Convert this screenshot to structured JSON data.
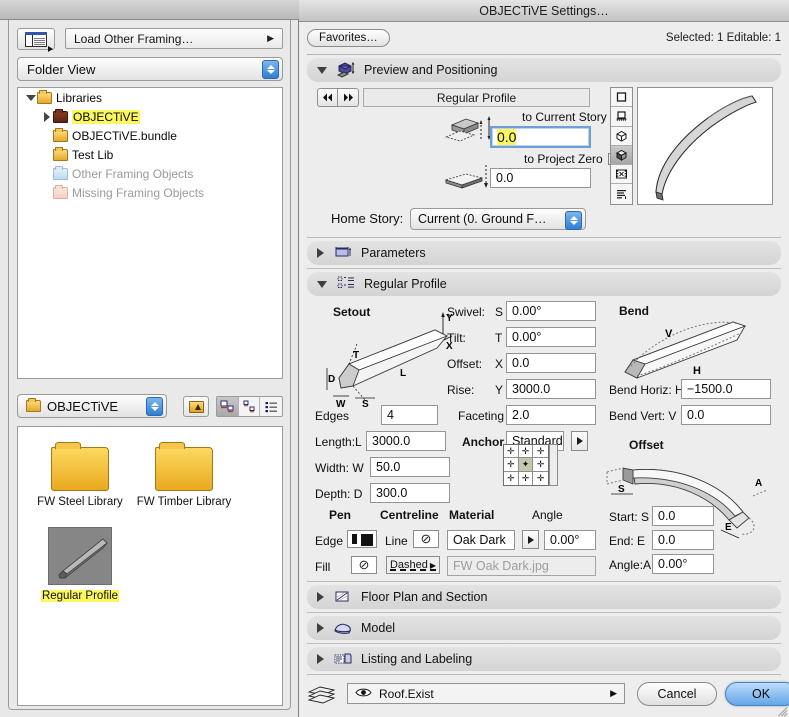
{
  "window": {
    "title": "OBJECTiVE Settings…"
  },
  "browser": {
    "listview_icon": "list-view-icon",
    "load_popup": "Load Other Framing…",
    "view_mode": "Folder View",
    "tree": [
      {
        "label": "Libraries",
        "indent": 0,
        "twisty": "down",
        "folder": "yellow",
        "dim": false,
        "highlight": false
      },
      {
        "label": "OBJECTiVE",
        "indent": 1,
        "twisty": "right",
        "folder": "dark",
        "dim": false,
        "highlight": true
      },
      {
        "label": "OBJECTiVE.bundle",
        "indent": 1,
        "twisty": "none",
        "folder": "yellow",
        "dim": false,
        "highlight": false
      },
      {
        "label": "Test Lib",
        "indent": 1,
        "twisty": "none",
        "folder": "yellow",
        "dim": false,
        "highlight": false
      },
      {
        "label": "Other Framing Objects",
        "indent": 1,
        "twisty": "none",
        "folder": "blue",
        "dim": true,
        "highlight": false
      },
      {
        "label": "Missing Framing Objects",
        "indent": 1,
        "twisty": "none",
        "folder": "pink",
        "dim": true,
        "highlight": false
      }
    ],
    "folder_popup": "OBJECTiVE",
    "up_button": "enclosing-folder-icon",
    "view_modes": [
      "large-icon-view",
      "small-icon-view",
      "list-detail-view"
    ],
    "items": [
      {
        "label": "FW Steel Library",
        "type": "folder"
      },
      {
        "label": "FW Timber Library",
        "type": "folder"
      },
      {
        "label": "Regular Profile",
        "type": "thumbnail",
        "highlight": true
      }
    ]
  },
  "dialog": {
    "favorites_button": "Favorites…",
    "selected_info": "Selected: 1 Editable: 1",
    "sections": [
      {
        "id": "preview",
        "title": "Preview and Positioning",
        "expanded": true,
        "icon": "preview-positioning-icon"
      },
      {
        "id": "parameters",
        "title": "Parameters",
        "expanded": false,
        "icon": "parameters-icon"
      },
      {
        "id": "profile",
        "title": "Regular Profile",
        "expanded": true,
        "icon": "regular-profile-icon"
      },
      {
        "id": "floorplan",
        "title": "Floor Plan and Section",
        "expanded": false,
        "icon": "floor-plan-icon"
      },
      {
        "id": "model",
        "title": "Model",
        "expanded": false,
        "icon": "model-icon"
      },
      {
        "id": "listing",
        "title": "Listing and Labeling",
        "expanded": false,
        "icon": "listing-icon"
      }
    ],
    "preview": {
      "prev_button": "prev-icon",
      "next_button": "next-icon",
      "object_name": "Regular Profile",
      "to_current_story_label": "to Current Story",
      "to_current_story_value": "0.0",
      "to_project_zero_label": "to Project Zero",
      "to_project_zero_value": "0.0",
      "home_story_label": "Home Story:",
      "home_story_value": "Current (0. Ground F…",
      "view_buttons": [
        "2d-symbol-view",
        "front-view",
        "3d-wireframe-view",
        "3d-shaded-view",
        "preview-picture-view",
        "list-view"
      ],
      "selected_view_index": 3
    },
    "profile": {
      "setout_caption": "Setout",
      "bend_caption": "Bend",
      "offset_caption": "Offset",
      "fields": [
        {
          "name": "swivel",
          "label": "Swivel:",
          "code": "S",
          "value": "0.00°"
        },
        {
          "name": "tilt",
          "label": "Tilt:",
          "code": "T",
          "value": "0.00°"
        },
        {
          "name": "offset-x",
          "label": "Offset:",
          "code": "X",
          "value": "0.0"
        },
        {
          "name": "rise",
          "label": "Rise:",
          "code": "Y",
          "value": "3000.0"
        },
        {
          "name": "edges",
          "label": "Edges",
          "code": "",
          "value": "4"
        },
        {
          "name": "length",
          "label": "Length:L",
          "code": "",
          "value": "3000.0"
        },
        {
          "name": "width",
          "label": "Width:  W",
          "code": "",
          "value": "50.0"
        },
        {
          "name": "depth",
          "label": "Depth:  D",
          "code": "",
          "value": "300.0"
        },
        {
          "name": "faceting",
          "label": "Faceting",
          "code": "",
          "value": "2.0"
        },
        {
          "name": "bend-horiz",
          "label": "Bend Horiz: H",
          "code": "",
          "value": "−1500.0"
        },
        {
          "name": "bend-vert",
          "label": "Bend Vert:  V",
          "code": "",
          "value": "0.0"
        },
        {
          "name": "start",
          "label": "Start:  S",
          "code": "",
          "value": "0.0"
        },
        {
          "name": "end",
          "label": "End:    E",
          "code": "",
          "value": "0.0"
        },
        {
          "name": "angle-a",
          "label": "Angle:A",
          "code": "",
          "value": "0.00°"
        }
      ],
      "anchor_label": "Anchor",
      "anchor_value": "Standard",
      "pen_caption": "Pen",
      "centreline_caption": "Centreline",
      "material_caption": "Material",
      "angle_caption": "Angle",
      "edge_label": "Edge",
      "fill_label": "Fill",
      "line_label": "Line",
      "line_type_value": "Dashed",
      "material_value": "Oak Dark",
      "material_angle_value": "0.00°",
      "texture_value": "FW Oak Dark.jpg"
    },
    "footer": {
      "layers_icon": "layers-icon",
      "eye_icon": "eye-icon",
      "layer_value": "Roof.Exist",
      "cancel_label": "Cancel",
      "ok_label": "OK"
    }
  },
  "colors": {
    "highlight_yellow": "#fbf75c",
    "ok_blue": "#63a6e8",
    "selection_blue": "#2f7ed4"
  }
}
